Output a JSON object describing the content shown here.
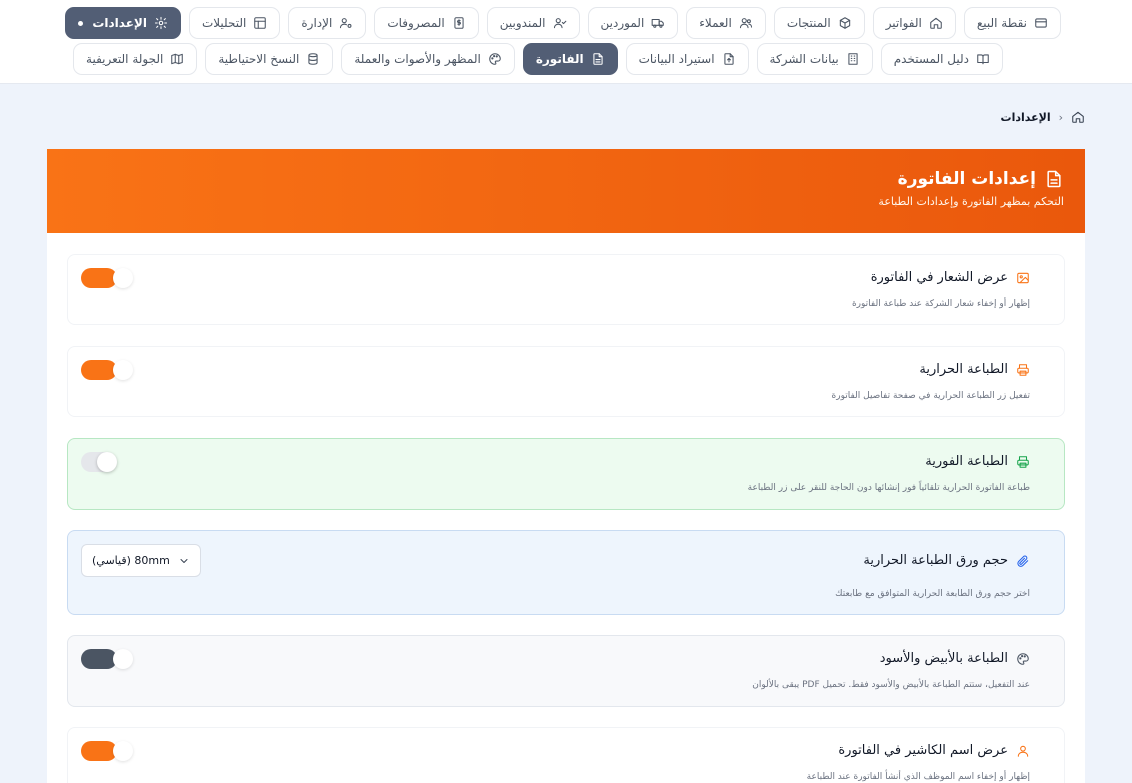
{
  "nav": {
    "row1": [
      {
        "key": "pos",
        "label": "نقطة البيع",
        "icon": "card-icon"
      },
      {
        "key": "invoices",
        "label": "الفواتير",
        "icon": "home-icon"
      },
      {
        "key": "products",
        "label": "المنتجات",
        "icon": "box-icon"
      },
      {
        "key": "customers",
        "label": "العملاء",
        "icon": "users-icon"
      },
      {
        "key": "suppliers",
        "label": "الموردين",
        "icon": "truck-icon"
      },
      {
        "key": "reps",
        "label": "المندوبين",
        "icon": "user-check-icon"
      },
      {
        "key": "expenses",
        "label": "المصروفات",
        "icon": "dollar-doc-icon"
      },
      {
        "key": "admin",
        "label": "الإدارة",
        "icon": "user-gear-icon"
      },
      {
        "key": "analytics",
        "label": "التحليلات",
        "icon": "layout-icon"
      },
      {
        "key": "settings",
        "label": "الإعدادات",
        "icon": "gear-icon",
        "active": true
      }
    ],
    "row2": [
      {
        "key": "guide",
        "label": "دليل المستخدم",
        "icon": "book-icon"
      },
      {
        "key": "company",
        "label": "بيانات الشركة",
        "icon": "building-icon"
      },
      {
        "key": "import",
        "label": "استيراد البيانات",
        "icon": "file-upload-icon"
      },
      {
        "key": "invoice",
        "label": "الفاتورة",
        "icon": "file-text-icon",
        "active": true
      },
      {
        "key": "appearance",
        "label": "المظهر والأصوات والعملة",
        "icon": "palette-icon"
      },
      {
        "key": "backup",
        "label": "النسخ الاحتياطية",
        "icon": "database-icon"
      },
      {
        "key": "tour",
        "label": "الجولة التعريفية",
        "icon": "map-icon"
      }
    ]
  },
  "breadcrumb": {
    "current": "الإعدادات"
  },
  "card": {
    "title": "إعدادات الفاتورة",
    "subtitle": "التحكم بمظهر الفاتورة وإعدادات الطباعة"
  },
  "settings": {
    "show_logo": {
      "title": "عرض الشعار في الفاتورة",
      "desc": "إظهار أو إخفاء شعار الشركة عند طباعة الفاتورة",
      "enabled": true
    },
    "thermal": {
      "title": "الطباعة الحرارية",
      "desc": "تفعيل زر الطباعة الحرارية في صفحة تفاصيل الفاتورة",
      "enabled": true
    },
    "instant": {
      "title": "الطباعة الفورية",
      "desc": "طباعة الفاتورة الحرارية تلقائياً فور إنشائها دون الحاجة للنقر على زر الطباعة",
      "enabled": false
    },
    "paper_size": {
      "title": "حجم ورق الطباعة الحرارية",
      "desc": "اختر حجم ورق الطابعة الحرارية المتوافق مع طابعتك",
      "value": "80mm (قياسي)"
    },
    "bw": {
      "title": "الطباعة بالأبيض والأسود",
      "desc": "عند التفعيل، ستتم الطباعة بالأبيض والأسود فقط. تحميل PDF يبقى بالألوان",
      "enabled": true
    },
    "cashier": {
      "title": "عرض اسم الكاشير في الفاتورة",
      "desc": "إظهار أو إخفاء اسم الموظف الذي أنشأ الفاتورة عند الطباعة",
      "enabled": true
    }
  },
  "colors": {
    "accent": "#f97316",
    "active_tab": "#525e75",
    "green_icon": "#16a34a",
    "blue_icon": "#2563eb"
  }
}
